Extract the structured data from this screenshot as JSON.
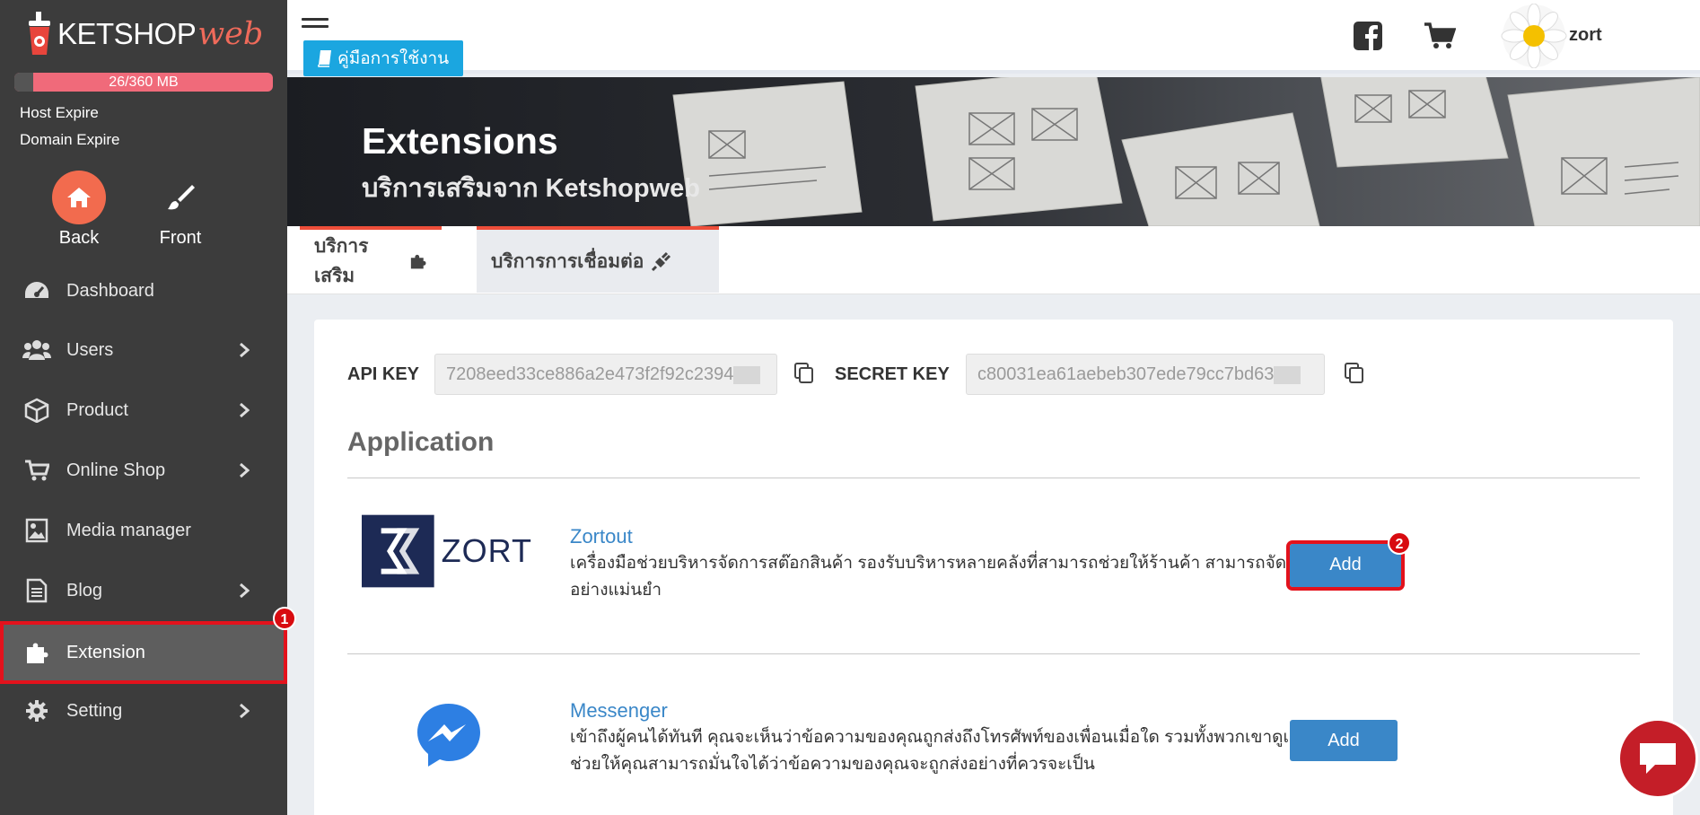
{
  "sidebar": {
    "brand": "KETSHOP",
    "brand_web": "web",
    "storage": {
      "text": "26/360 MB",
      "used_fraction": 0.072
    },
    "host_expire": "Host Expire",
    "domain_expire": "Domain Expire",
    "modes": {
      "back": "Back",
      "front": "Front"
    },
    "items": [
      {
        "label": "Dashboard",
        "icon": "dashboard-icon"
      },
      {
        "label": "Users",
        "icon": "users-icon"
      },
      {
        "label": "Product",
        "icon": "box-icon"
      },
      {
        "label": "Online Shop",
        "icon": "cart-icon"
      },
      {
        "label": "Media manager",
        "icon": "image-icon"
      },
      {
        "label": "Blog",
        "icon": "document-icon"
      },
      {
        "label": "Extension",
        "icon": "puzzle-icon"
      },
      {
        "label": "Setting",
        "icon": "gear-icon"
      }
    ],
    "badge1": "1"
  },
  "topbar": {
    "manual_label": "คู่มือการใช้งาน",
    "username": "zort"
  },
  "hero": {
    "title": "Extensions",
    "subtitle": "บริการเสริมจาก Ketshopweb"
  },
  "tabs": [
    {
      "label": "บริการเสริม"
    },
    {
      "label": "บริการการเชื่อมต่อ"
    }
  ],
  "keys": {
    "api_label": "API KEY",
    "api_value": "7208eed33ce886a2e473f2f92c2394",
    "secret_label": "SECRET KEY",
    "secret_value": "c80031ea61aebeb307ede79cc7bd63"
  },
  "application": {
    "heading": "Application",
    "apps": [
      {
        "name": "Zortout",
        "logo_text": "ZORT",
        "description": "เครื่องมือช่วยบริหารจัดการสต๊อกสินค้า รองรับบริหารหลายคลังที่สามารถช่วยให้ร้านค้า สามารถจัดการสินค้าได้อย่างแม่นยำ",
        "button": "Add"
      },
      {
        "name": "Messenger",
        "description": "เข้าถึงผู้คนได้ทันที คุณจะเห็นว่าข้อความของคุณถูกส่งถึงโทรศัพท์ของเพื่อนเมื่อใด รวมทั้งพวกเขาดูเมื่อใด วิธีนี้จะช่วยให้คุณสามารถมั่นใจได้ว่าข้อความของคุณจะถูกส่งอย่างที่ควรจะเป็น",
        "button": "Add"
      }
    ],
    "badge2": "2"
  },
  "colors": {
    "sidebar_bg": "#3c3c3c",
    "accent_red": "#e3121c",
    "primary_blue": "#3a87c8",
    "manual_btn": "#1ba6e0",
    "back_orange": "#f26b4e"
  }
}
